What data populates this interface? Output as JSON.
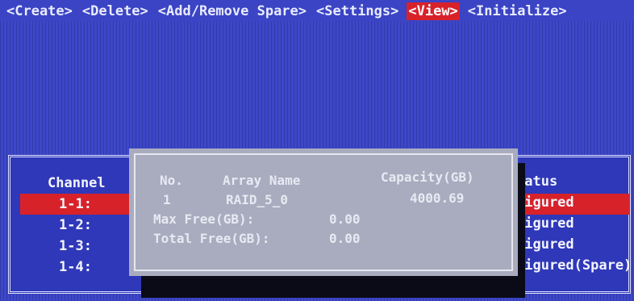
{
  "menu": [
    {
      "label": "<Create>",
      "active": false
    },
    {
      "label": "<Delete>",
      "active": false
    },
    {
      "label": "<Add/Remove Spare>",
      "active": false
    },
    {
      "label": "<Settings>",
      "active": false
    },
    {
      "label": "<View>",
      "active": true
    },
    {
      "label": "<Initialize>",
      "active": false
    }
  ],
  "list": {
    "channel_header": "Channel",
    "status_header": "tatus",
    "rows": [
      {
        "channel": "1-1:",
        "status": "figured",
        "selected": true
      },
      {
        "channel": "1-2:",
        "status": "figured",
        "selected": false
      },
      {
        "channel": "1-3:",
        "status": "figured",
        "selected": false
      },
      {
        "channel": "1-4:",
        "status": "figured(Spare)",
        "selected": false
      }
    ]
  },
  "popup": {
    "headers": {
      "no": "No.",
      "array_name": "Array Name",
      "capacity": "Capacity(GB)"
    },
    "array": {
      "no": "1",
      "name": "RAID_5_0",
      "capacity": "4000.69"
    },
    "max_free_label": "Max Free(GB):",
    "max_free_value": "0.00",
    "total_free_label": "Total Free(GB):",
    "total_free_value": "0.00"
  },
  "colors": {
    "background": "#3d47c8",
    "highlight": "#d8222a",
    "popup": "#a9acbf"
  }
}
